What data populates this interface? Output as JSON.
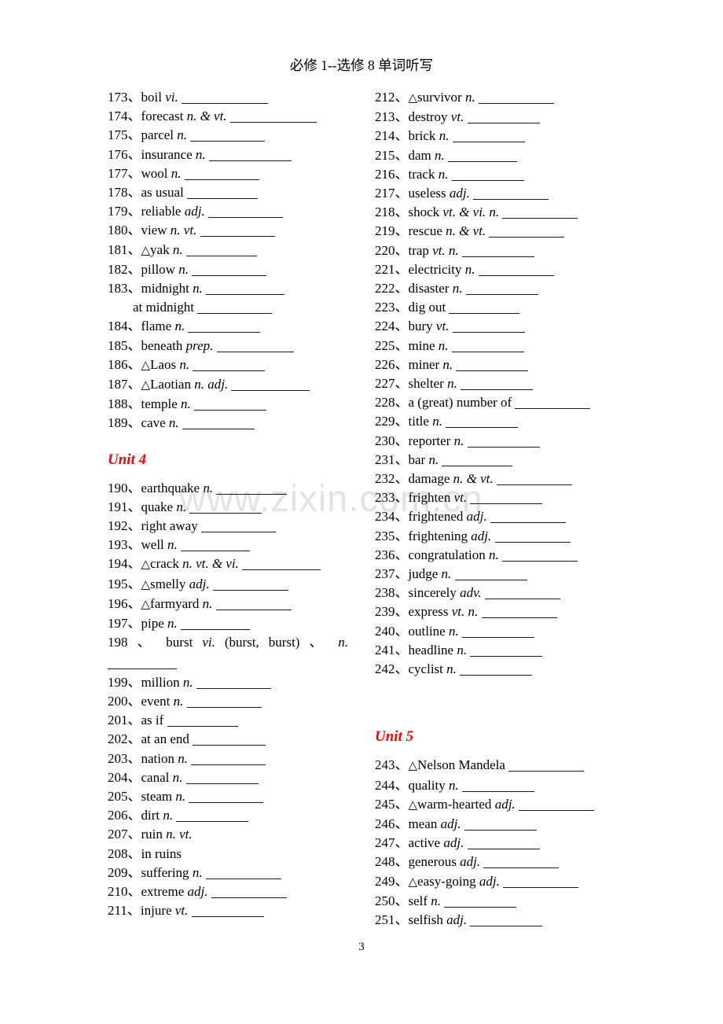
{
  "header": {
    "title": "必修 1--选修 8 单词听写"
  },
  "watermark": {
    "text": "www.zixin.com.cn"
  },
  "footer": {
    "page_number": "3"
  },
  "colors": {
    "unit_heading": "#ff0000",
    "body_text": "#000000",
    "watermark": "#e3e3e6"
  },
  "left_column": {
    "entries": [
      {
        "num": "173、",
        "word": "boil ",
        "pos": "vi.",
        "blank": 110
      },
      {
        "num": "174、",
        "word": "forecast ",
        "pos": "n. & vt.",
        "blank": 110
      },
      {
        "num": "175、",
        "word": "parcel ",
        "pos": "n.",
        "blank": 95
      },
      {
        "num": "176、",
        "word": "insurance ",
        "pos": "n.",
        "blank": 105
      },
      {
        "num": "177、",
        "word": "wool ",
        "pos": "n.",
        "blank": 95
      },
      {
        "num": "178、",
        "word": "as usual",
        "pos": "",
        "blank": 90
      },
      {
        "num": "179、",
        "word": "reliable ",
        "pos": "adj.",
        "blank": 95
      },
      {
        "num": "180、",
        "word": "view ",
        "pos": "n.    vt.",
        "blank": 95
      },
      {
        "num": "181、",
        "word": "△yak ",
        "pos": "n.",
        "blank": 90
      },
      {
        "num": "182、",
        "word": "pillow ",
        "pos": "n.",
        "blank": 95
      },
      {
        "num": "183、",
        "word": "midnight ",
        "pos": "n.",
        "blank": 100
      }
    ],
    "sub_entry": {
      "text": "at midnight",
      "blank": 95
    },
    "entries2": [
      {
        "num": "184、",
        "word": "flame ",
        "pos": "n.",
        "blank": 92
      },
      {
        "num": "185、",
        "word": "beneath ",
        "pos": "prep.",
        "blank": 98
      },
      {
        "num": "186、",
        "word": "△Laos ",
        "pos": "n.",
        "blank": 92
      },
      {
        "num": "187、",
        "word": "△Laotian    ",
        "pos": "n.    adj.",
        "blank": 100
      },
      {
        "num": "188、",
        "word": "temple ",
        "pos": "n.",
        "blank": 92
      },
      {
        "num": "189、",
        "word": "cave ",
        "pos": "n.",
        "blank": 92
      }
    ],
    "unit_heading": "Unit 4",
    "entries3": [
      {
        "num": "190、",
        "word": "earthquake ",
        "pos": "n.",
        "blank": 90
      },
      {
        "num": "191、",
        "word": "quake ",
        "pos": "n.",
        "blank": 92
      },
      {
        "num": "192、",
        "word": "right away",
        "pos": "",
        "blank": 95
      },
      {
        "num": "193、",
        "word": "well ",
        "pos": "n.",
        "blank": 88
      },
      {
        "num": "194、",
        "word": "△crack ",
        "pos": "n.    vt. & vi.",
        "blank": 100
      },
      {
        "num": "195、",
        "word": "△smelly ",
        "pos": "adj.",
        "blank": 96
      },
      {
        "num": "196、",
        "word": "△farmyard ",
        "pos": "n.",
        "blank": 96
      },
      {
        "num": "197、",
        "word": "pipe ",
        "pos": "n.",
        "blank": 88
      }
    ],
    "wrapped_entry": {
      "num": "198 、",
      "word": "burst ",
      "pos": "vi.",
      "detail": "(burst, burst)   、",
      "pos2": "n.",
      "blank": 88
    },
    "entries4": [
      {
        "num": "199、",
        "word": "million ",
        "pos": "n.",
        "blank": 95
      },
      {
        "num": "200、",
        "word": "event ",
        "pos": "n.",
        "blank": 95
      },
      {
        "num": "201、",
        "word": "as if",
        "pos": "",
        "blank": 90
      },
      {
        "num": "202、",
        "word": "at an end",
        "pos": "",
        "blank": 93
      },
      {
        "num": "203、",
        "word": "nation ",
        "pos": "n.",
        "blank": 95
      },
      {
        "num": "204、",
        "word": "canal ",
        "pos": "n.",
        "blank": 92
      },
      {
        "num": "205、",
        "word": "steam ",
        "pos": "n.",
        "blank": 95
      },
      {
        "num": "206、",
        "word": "dirt ",
        "pos": "n.",
        "blank": 92
      },
      {
        "num": "207、",
        "word": "ruin ",
        "pos": "n.    vt.",
        "blank": 0
      },
      {
        "num": "208、",
        "word": "in ruins",
        "pos": "",
        "blank": 0
      },
      {
        "num": "209、",
        "word": "suffering ",
        "pos": "n.",
        "blank": 96
      },
      {
        "num": "210、",
        "word": "extreme ",
        "pos": "adj.",
        "blank": 96
      },
      {
        "num": "211、",
        "word": "injure   ",
        "pos": "vt.",
        "blank": 92
      }
    ]
  },
  "right_column": {
    "entries": [
      {
        "num": "212、",
        "word": "△survivor ",
        "pos": "n.",
        "blank": 96
      },
      {
        "num": "213、",
        "word": "destroy   ",
        "pos": "vt.",
        "blank": 92
      },
      {
        "num": "214、",
        "word": "brick ",
        "pos": "n.",
        "blank": 92
      },
      {
        "num": "215、",
        "word": "dam ",
        "pos": "n.",
        "blank": 88
      },
      {
        "num": "216、",
        "word": "track ",
        "pos": "n.",
        "blank": 92
      },
      {
        "num": "217、",
        "word": "useless ",
        "pos": "adj.",
        "blank": 96
      },
      {
        "num": "218、",
        "word": "shock   ",
        "pos": "vt. & vi.     n.",
        "blank": 96
      },
      {
        "num": "219、",
        "word": "rescue ",
        "pos": "n. & vt.",
        "blank": 96
      },
      {
        "num": "220、",
        "word": "trap ",
        "pos": "vt. n.",
        "blank": 92
      },
      {
        "num": "221、",
        "word": "electricity ",
        "pos": "n.",
        "blank": 96
      },
      {
        "num": "222、",
        "word": "disaster ",
        "pos": "n.",
        "blank": 92
      },
      {
        "num": "223、",
        "word": "dig out",
        "pos": "",
        "blank": 90
      },
      {
        "num": "224、",
        "word": "bury ",
        "pos": "vt.",
        "blank": 92
      },
      {
        "num": "225、",
        "word": "mine ",
        "pos": "n.",
        "blank": 92
      },
      {
        "num": "226、",
        "word": "miner ",
        "pos": "n.",
        "blank": 92
      },
      {
        "num": "227、",
        "word": "shelter ",
        "pos": "n.",
        "blank": 92
      },
      {
        "num": "228、",
        "word": "a (great) number of",
        "pos": "",
        "blank": 96
      },
      {
        "num": "229、",
        "word": "title ",
        "pos": "n.",
        "blank": 92
      },
      {
        "num": "230、",
        "word": "reporter ",
        "pos": "n.",
        "blank": 92
      },
      {
        "num": "231、",
        "word": "bar ",
        "pos": "n.",
        "blank": 90
      },
      {
        "num": "232、",
        "word": "damage ",
        "pos": "n. & vt.",
        "blank": 96
      },
      {
        "num": "233、",
        "word": "frighten ",
        "pos": "vt.",
        "blank": 92
      },
      {
        "num": "234、",
        "word": "frightened ",
        "pos": "adj.",
        "blank": 96
      },
      {
        "num": "235、",
        "word": "frightening ",
        "pos": "adj.",
        "blank": 96
      },
      {
        "num": "236、",
        "word": "congratulation ",
        "pos": "n.",
        "blank": 96
      },
      {
        "num": "237、",
        "word": "judge ",
        "pos": "n.",
        "blank": 92
      },
      {
        "num": "238、",
        "word": "sincerely ",
        "pos": "adv.",
        "blank": 96
      },
      {
        "num": "239、",
        "word": "express   ",
        "pos": "vt.    n.",
        "blank": 96
      },
      {
        "num": "240、",
        "word": "outline ",
        "pos": "n.",
        "blank": 92
      },
      {
        "num": "241、",
        "word": "headline ",
        "pos": "n.",
        "blank": 92
      },
      {
        "num": "242、",
        "word": "cyclist ",
        "pos": "n.",
        "blank": 92
      }
    ],
    "unit_heading": "Unit 5",
    "entries2": [
      {
        "num": "243、",
        "word": "△Nelson Mandela",
        "pos": "",
        "blank": 96
      },
      {
        "num": "244、",
        "word": "quality ",
        "pos": "n.",
        "blank": 92
      },
      {
        "num": "245、",
        "word": "△warm-hearted ",
        "pos": "adj.",
        "blank": 96
      },
      {
        "num": "246、",
        "word": "mean ",
        "pos": "adj.",
        "blank": 92
      },
      {
        "num": "247、",
        "word": "active ",
        "pos": "adj.",
        "blank": 92
      },
      {
        "num": "248、",
        "word": "generous ",
        "pos": "adj.",
        "blank": 96
      },
      {
        "num": "249、",
        "word": "△easy-going ",
        "pos": "adj.",
        "blank": 96
      },
      {
        "num": "250、",
        "word": "self    ",
        "pos": "n.",
        "blank": 92
      },
      {
        "num": "251、",
        "word": "selfish ",
        "pos": "adj.",
        "blank": 92
      }
    ]
  }
}
